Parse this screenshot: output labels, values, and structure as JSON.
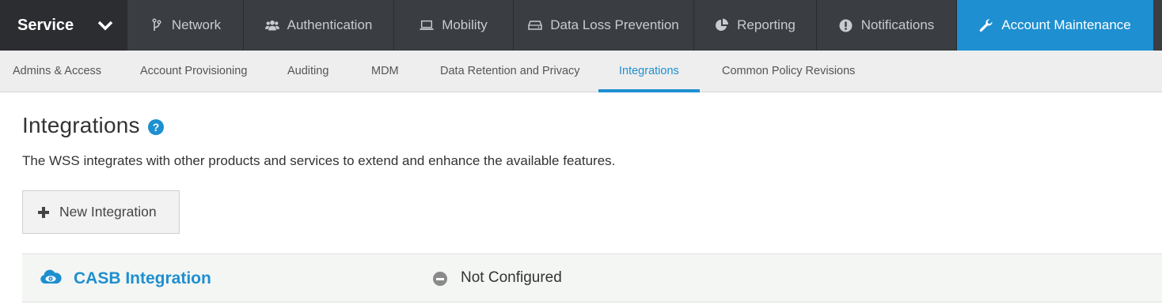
{
  "topnav": {
    "service_label": "Service",
    "tabs": [
      {
        "label": "Network",
        "icon": "branch-icon"
      },
      {
        "label": "Authentication",
        "icon": "users-icon"
      },
      {
        "label": "Mobility",
        "icon": "laptop-icon"
      },
      {
        "label": "Data Loss Prevention",
        "icon": "drive-icon"
      },
      {
        "label": "Reporting",
        "icon": "pie-chart-icon"
      },
      {
        "label": "Notifications",
        "icon": "exclamation-icon"
      },
      {
        "label": "Account Maintenance",
        "icon": "wrench-icon",
        "active": true
      }
    ]
  },
  "subnav": {
    "tabs": [
      {
        "label": "Admins & Access"
      },
      {
        "label": "Account Provisioning"
      },
      {
        "label": "Auditing"
      },
      {
        "label": "MDM"
      },
      {
        "label": "Data Retention and Privacy"
      },
      {
        "label": "Integrations",
        "active": true
      },
      {
        "label": "Common Policy Revisions"
      }
    ]
  },
  "main": {
    "title": "Integrations",
    "help_glyph": "?",
    "description": "The WSS integrates with other products and services to extend and enhance the available features.",
    "new_button_label": "New Integration",
    "integrations": [
      {
        "name": "CASB Integration",
        "icon": "cloud-eye-icon",
        "status": "Not Configured",
        "status_icon": "minus-circle-icon"
      }
    ]
  },
  "colors": {
    "accent": "#1e8fd0",
    "topnav_bg": "#3a3d41",
    "service_bg": "#2b2d30",
    "subnav_bg": "#eeeeee"
  }
}
